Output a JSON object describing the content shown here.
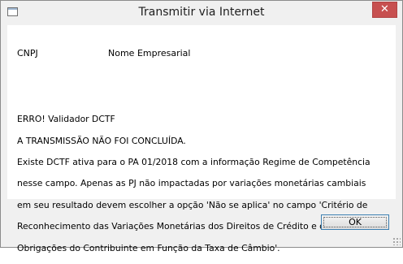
{
  "window": {
    "title": "Transmitir via Internet",
    "close_glyph": "✕"
  },
  "table": {
    "headers": [
      "CNPJ",
      "Nome Empresarial"
    ]
  },
  "message": {
    "lines": [
      "ERRO! Validador DCTF",
      "A TRANSMISSÃO NÃO FOI CONCLUÍDA.",
      "Existe DCTF ativa para o PA 01/2018  com a informação Regime de Competência",
      "nesse campo. Apenas as PJ não impactadas por variações monetárias cambiais",
      "em seu resultado devem escolher a opção 'Não se aplica' no campo 'Critério de",
      "Reconhecimento das Variações Monetárias dos Direitos de Crédito e das",
      "Obrigações do Contribuinte em Função da Taxa de Câmbio'."
    ]
  },
  "buttons": {
    "ok_label": "OK"
  },
  "colors": {
    "close_button": "#c75050",
    "focus_border": "#3c7fb1"
  }
}
